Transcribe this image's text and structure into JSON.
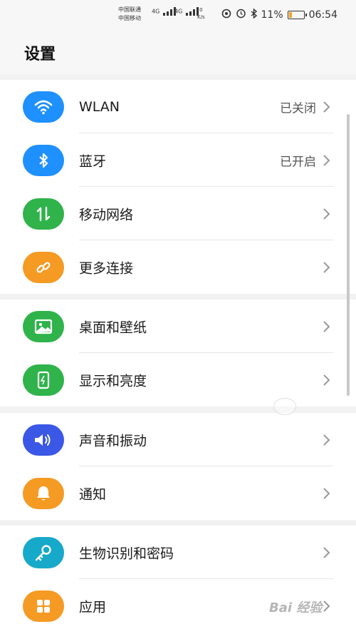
{
  "status_bar": {
    "carrier_1": "中国联通",
    "carrier_2": "中国移动",
    "sig_1": "4G",
    "sig_2": "4G",
    "speed_value": "0",
    "speed_unit": "K/s",
    "battery_percent": "11%",
    "time": "06:54"
  },
  "header": {
    "title": "设置"
  },
  "groups": [
    {
      "items": [
        {
          "label": "WLAN",
          "value": "已关闭",
          "icon": "wifi-icon",
          "color": "#1e90ff"
        },
        {
          "label": "蓝牙",
          "value": "已开启",
          "icon": "bluetooth-icon",
          "color": "#1e90ff"
        },
        {
          "label": "移动网络",
          "value": "",
          "icon": "mobile-data-icon",
          "color": "#2fb34a"
        },
        {
          "label": "更多连接",
          "value": "",
          "icon": "link-icon",
          "color": "#f59a23"
        }
      ]
    },
    {
      "items": [
        {
          "label": "桌面和壁纸",
          "value": "",
          "icon": "wallpaper-icon",
          "color": "#2fb34a"
        },
        {
          "label": "显示和亮度",
          "value": "",
          "icon": "display-icon",
          "color": "#2fb34a"
        }
      ]
    },
    {
      "items": [
        {
          "label": "声音和振动",
          "value": "",
          "icon": "sound-icon",
          "color": "#3b57e6"
        },
        {
          "label": "通知",
          "value": "",
          "icon": "notification-icon",
          "color": "#f59a23"
        }
      ]
    },
    {
      "items": [
        {
          "label": "生物识别和密码",
          "value": "",
          "icon": "key-icon",
          "color": "#17a9c9"
        },
        {
          "label": "应用",
          "value": "",
          "icon": "apps-icon",
          "color": "#f59a23"
        }
      ]
    }
  ],
  "watermark": "Bai 经验"
}
